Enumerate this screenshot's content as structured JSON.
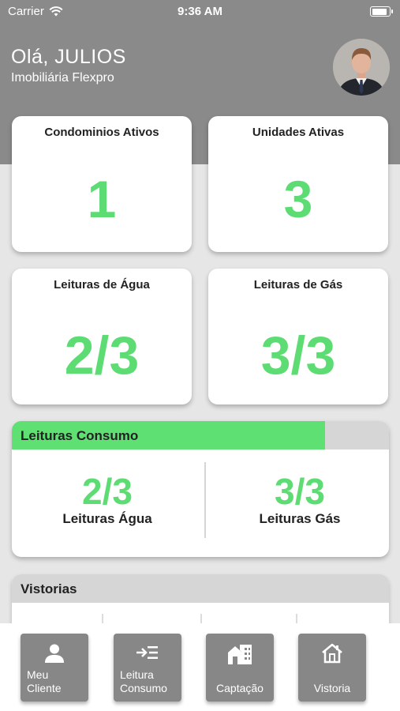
{
  "status_bar": {
    "carrier": "Carrier",
    "time": "9:36 AM"
  },
  "header": {
    "greeting": "Olá, JULIOS",
    "company": "Imobiliária Flexpro"
  },
  "cards": {
    "condominios": {
      "title": "Condominios Ativos",
      "value": "1"
    },
    "unidades": {
      "title": "Unidades Ativas",
      "value": "3"
    },
    "agua": {
      "title": "Leituras de Água",
      "value": "2/3"
    },
    "gas": {
      "title": "Leituras de Gás",
      "value": "3/3"
    }
  },
  "consumo": {
    "title": "Leituras Consumo",
    "progress_fraction": 0.83,
    "agua_value": "2/3",
    "agua_label": "Leituras Água",
    "gas_value": "3/3",
    "gas_label": "Leituras Gás"
  },
  "vistorias": {
    "title": "Vistorias"
  },
  "tabbar": {
    "meu_cliente": "Meu\nCliente",
    "leitura_consumo": "Leitura\nConsumo",
    "captacao": "Captação",
    "vistoria": "Vistoria"
  },
  "colors": {
    "accent_green": "#5edc74",
    "header_gray": "#8a8a8a",
    "tab_gray": "#878787"
  },
  "icons": [
    "wifi-icon",
    "battery-icon",
    "person-icon",
    "list-arrow-icon",
    "buildings-icon",
    "house-icon"
  ]
}
